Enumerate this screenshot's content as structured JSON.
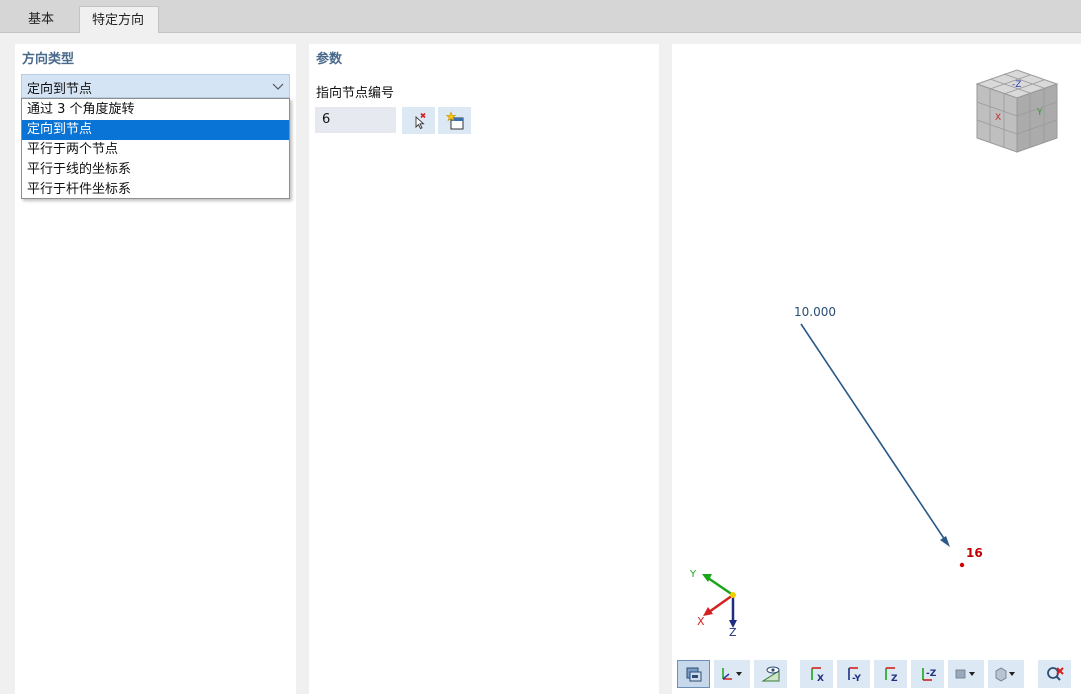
{
  "tabs": [
    {
      "label": "基本",
      "active": false
    },
    {
      "label": "特定方向",
      "active": true
    }
  ],
  "direction_type": {
    "title": "方向类型",
    "selected": "定向到节点",
    "options": [
      "通过 3 个角度旋转",
      "定向到节点",
      "平行于两个节点",
      "平行于线的坐标系",
      "平行于杆件坐标系"
    ]
  },
  "params": {
    "title": "参数",
    "node_label": "指向节点编号",
    "node_value": "6"
  },
  "view": {
    "length_label": "10.000",
    "node_number": "16",
    "axes": {
      "x": "X",
      "y": "Y",
      "z": "Z"
    },
    "toolbar_icons": [
      "display-options-icon",
      "axis-system-icon",
      "visibility-icon",
      "view-x-icon",
      "view-minus-y-icon",
      "view-z-icon",
      "view-minus-z-icon",
      "render-mode-icon",
      "cube-view-icon",
      "clear-selection-icon"
    ]
  },
  "colors": {
    "accent": "#0a74d6",
    "title": "#4a6a8c",
    "vector": "#2a5a86",
    "node": "#c00000"
  }
}
